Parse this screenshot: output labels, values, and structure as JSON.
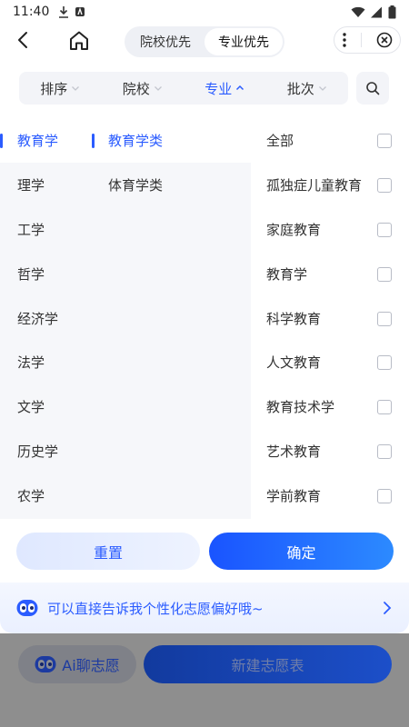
{
  "status_bar": {
    "time": "11:40"
  },
  "header": {
    "segments": [
      {
        "label": "院校优先",
        "active": false
      },
      {
        "label": "专业优先",
        "active": true
      }
    ]
  },
  "filters": [
    {
      "label": "排序",
      "active": false
    },
    {
      "label": "院校",
      "active": false
    },
    {
      "label": "专业",
      "active": true
    },
    {
      "label": "批次",
      "active": false
    }
  ],
  "categories": [
    {
      "label": "教育学",
      "active": true
    },
    {
      "label": "理学",
      "active": false
    },
    {
      "label": "工学",
      "active": false
    },
    {
      "label": "哲学",
      "active": false
    },
    {
      "label": "经济学",
      "active": false
    },
    {
      "label": "法学",
      "active": false
    },
    {
      "label": "文学",
      "active": false
    },
    {
      "label": "历史学",
      "active": false
    },
    {
      "label": "农学",
      "active": false
    }
  ],
  "subcategories": [
    {
      "label": "教育学类",
      "active": true
    },
    {
      "label": "体育学类",
      "active": false
    }
  ],
  "majors": [
    {
      "label": "全部",
      "checked": false
    },
    {
      "label": "孤独症儿童教育",
      "checked": false
    },
    {
      "label": "家庭教育",
      "checked": false
    },
    {
      "label": "教育学",
      "checked": false
    },
    {
      "label": "科学教育",
      "checked": false
    },
    {
      "label": "人文教育",
      "checked": false
    },
    {
      "label": "教育技术学",
      "checked": false
    },
    {
      "label": "艺术教育",
      "checked": false
    },
    {
      "label": "学前教育",
      "checked": false
    }
  ],
  "actions": {
    "reset": "重置",
    "confirm": "确定"
  },
  "ai_banner": {
    "text": "可以直接告诉我个性化志愿偏好哦~"
  },
  "bottom": {
    "ai_chat": "Ai聊志愿",
    "new_form": "新建志愿表"
  },
  "colors": {
    "accent": "#2b5cff",
    "panel_bg": "#f6f7fa"
  }
}
